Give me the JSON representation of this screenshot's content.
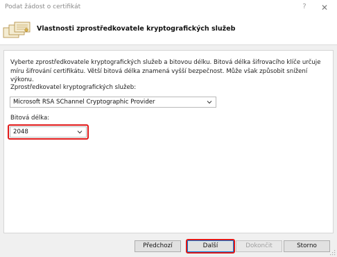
{
  "window": {
    "title": "Podat žádost o certifikát",
    "help_glyph": "?",
    "close_glyph": "✕"
  },
  "header": {
    "title": "Vlastnosti zprostředkovatele kryptografických služeb"
  },
  "content": {
    "description": "Vyberte zprostředkovatele kryptografických služeb a bitovou délku. Bitová délka šifrovacího klíče určuje míru šifrování certifikátu. Větší bitová délka znamená vyšší bezpečnost. Může však způsobit snížení výkonu.",
    "provider_label": "Zprostředkovatel kryptografických služeb:",
    "provider_value": "Microsoft RSA SChannel Cryptographic Provider",
    "bitlength_label": "Bitová délka:",
    "bitlength_value": "2048"
  },
  "footer": {
    "back_label": "Předchozí",
    "next_label": "Další",
    "finish_label": "Dokončit",
    "cancel_label": "Storno"
  },
  "colors": {
    "highlight": "#e01919",
    "default_button_border": "#0078d7"
  },
  "icons": {
    "header": "certificate-stack-icon",
    "dropdown": "chevron-down-icon"
  }
}
